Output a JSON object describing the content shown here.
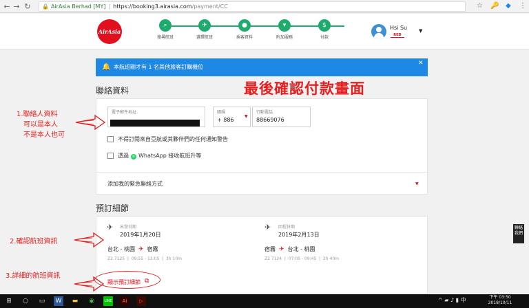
{
  "browser": {
    "org": "AirAsia Berhad [MY]",
    "host": "https://booking3.airasia.com",
    "path": "/payment/CC",
    "icons": [
      "back-icon",
      "forward-icon",
      "refresh-icon",
      "lock-icon",
      "star-icon",
      "extension-icon",
      "extension2-icon",
      "menu-icon"
    ]
  },
  "header": {
    "logo_text": "AirAsia",
    "steps": [
      {
        "label": "搜尋航班",
        "icon": "search-icon"
      },
      {
        "label": "選擇航班",
        "icon": "plane-icon"
      },
      {
        "label": "乘客資料",
        "icon": "person-icon"
      },
      {
        "label": "附加服務",
        "icon": "cart-icon"
      },
      {
        "label": "付款",
        "icon": "dollar-icon"
      }
    ],
    "user_name": "Hsi Su",
    "user_badge": "RED",
    "accent": "#1faa6e",
    "brand": "#e1101f"
  },
  "notice": {
    "text": "本航班剛才有 1 名其他旅客訂購機位",
    "color": "#1e88e5"
  },
  "contact": {
    "title": "聯絡資料",
    "email_label": "電子郵件地址",
    "country_code_label": "國碼",
    "country_code_value": "+ 886",
    "phone_label": "行動電話",
    "phone_value": "88669076",
    "checkbox1": "不得訂閱來自亞航或其夥伴們的任何通知警告",
    "checkbox2_prefix": "透過",
    "checkbox2_suffix": "WhatsApp 接收航班升等",
    "emergency": "添加我的緊急聯絡方式"
  },
  "booking": {
    "title": "預訂細節",
    "depart": {
      "label": "出發日期",
      "date": "2019年1月20日",
      "from": "台北 - 桃園",
      "to": "宿霧",
      "flight": "Z2 7125",
      "time": "09:55 - 13:05",
      "duration": "3h 10m"
    },
    "return": {
      "label": "回程日期",
      "date": "2019年2月13日",
      "from": "宿霧",
      "to": "台北 - 桃園",
      "flight": "Z2 7124",
      "time": "07:05 - 09:45",
      "duration": "2h 40m"
    },
    "show_details": "顯示預訂細節"
  },
  "annotations": {
    "title": "最後確認付款畫面",
    "a1_line1": "1.聯絡人資料",
    "a1_line2": "可以是本人",
    "a1_line3": "不是本人也可",
    "a2": "2.確認航班資訊",
    "a3": "3.詳細的航班資訊",
    "color": "#e41f1f"
  },
  "side_tab": "聯絡我們",
  "taskbar": {
    "time": "下午 03:50",
    "date": "2018/10/11",
    "ime": "中"
  }
}
